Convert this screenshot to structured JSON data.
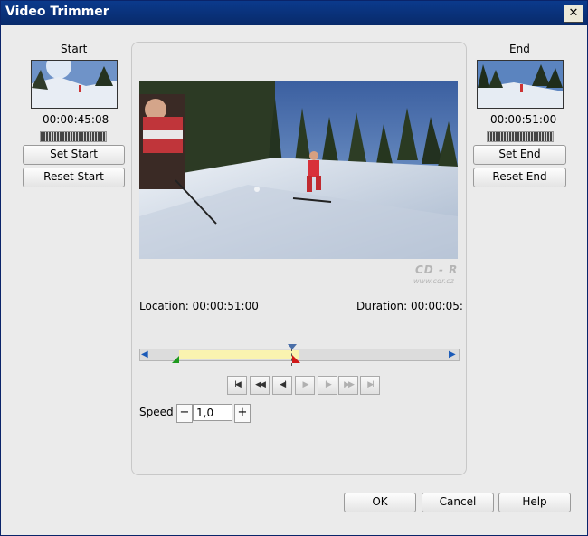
{
  "window": {
    "title": "Video Trimmer",
    "close_label": "✕"
  },
  "start": {
    "label": "Start",
    "timecode": "00:00:45:08",
    "set_label": "Set Start",
    "reset_label": "Reset Start"
  },
  "end": {
    "label": "End",
    "timecode": "00:00:51:00",
    "set_label": "Set End",
    "reset_label": "Reset End"
  },
  "preview": {
    "watermark_line1": "CD - R",
    "watermark_line2": "www.cdr.cz"
  },
  "location": {
    "label": "Location:",
    "value": "00:00:51:00"
  },
  "duration": {
    "label": "Duration:",
    "value": "00:00:05:"
  },
  "transport": {
    "go_start": "I◀",
    "rewind": "◀◀",
    "step_back": "◀I",
    "play": "▶",
    "step_forward": "I▶",
    "fast_forward": "▶▶",
    "go_end": "▶I"
  },
  "speed": {
    "label": "Speed",
    "minus": "−",
    "plus": "+",
    "value": "1,0"
  },
  "footer": {
    "ok": "OK",
    "cancel": "Cancel",
    "help": "Help"
  },
  "colors": {
    "titlebar": "#0b3a8c",
    "selection": "#faf3b0",
    "in_marker": "#1e9a1e",
    "out_marker": "#d01818"
  }
}
